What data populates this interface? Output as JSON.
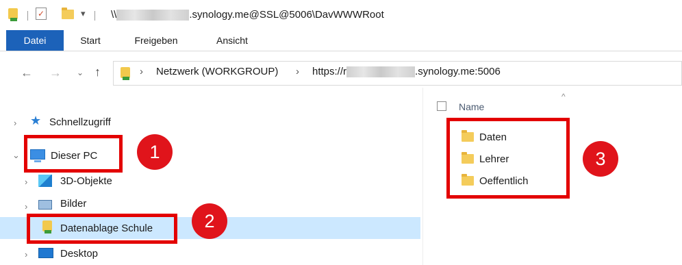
{
  "window": {
    "title_prefix": "\\\\",
    "title_suffix": ".synology.me@SSL@5006\\DavWWWRoot"
  },
  "ribbon": {
    "tabs": [
      {
        "label": "Datei"
      },
      {
        "label": "Start"
      },
      {
        "label": "Freigeben"
      },
      {
        "label": "Ansicht"
      }
    ]
  },
  "address": {
    "segment_1": "Netzwerk (WORKGROUP)",
    "segment_2_prefix": "https://r",
    "segment_2_suffix": ".synology.me:5006"
  },
  "nav_pane": {
    "items": [
      {
        "label": "Schnellzugriff",
        "icon": "star-icon"
      },
      {
        "label": "Dieser PC",
        "icon": "computer-icon"
      },
      {
        "label": "3D-Objekte",
        "icon": "cube-icon"
      },
      {
        "label": "Bilder",
        "icon": "pictures-icon"
      },
      {
        "label": "Datenablage Schule",
        "icon": "network-drive-icon"
      },
      {
        "label": "Desktop",
        "icon": "desktop-icon"
      }
    ]
  },
  "content": {
    "column_name": "Name",
    "files": [
      {
        "name": "Daten"
      },
      {
        "name": "Lehrer"
      },
      {
        "name": "Oeffentlich"
      }
    ]
  },
  "annotations": {
    "badge_1": "1",
    "badge_2": "2",
    "badge_3": "3",
    "highlight_color": "#e30000"
  },
  "colors": {
    "file_tab": "#1c62b9",
    "selection": "#cce8ff"
  }
}
